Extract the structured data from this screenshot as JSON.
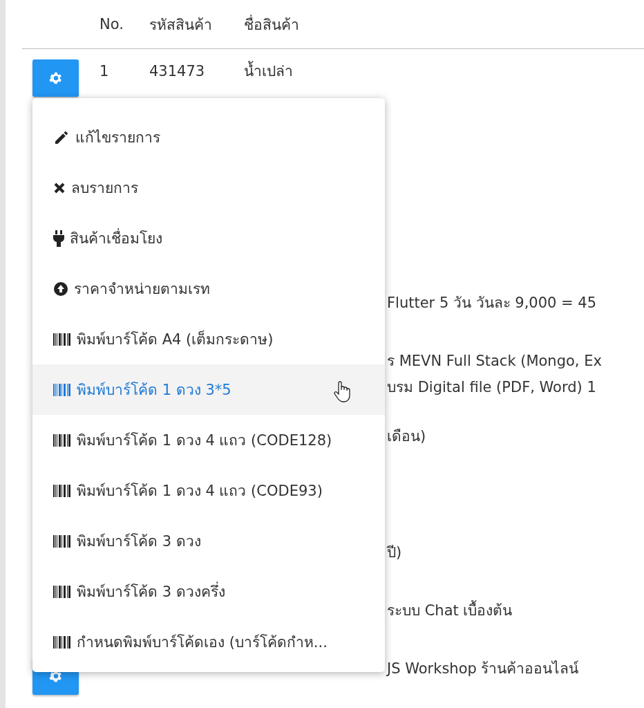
{
  "table": {
    "columns": [
      "No.",
      "รหัสสินค้า",
      "ชื่อสินค้า"
    ],
    "rows": [
      {
        "kind": "full",
        "no": "1",
        "code": "431473",
        "name": "น้ำเปล่า"
      },
      {
        "kind": "covered",
        "name_lines": [
          "Flutter 5 วัน วันละ 9,000 = 45"
        ]
      },
      {
        "kind": "covered",
        "name_lines": [
          "ร MEVN Full Stack (Mongo, Ex",
          "บรม Digital file (PDF, Word) 1"
        ]
      },
      {
        "kind": "covered",
        "name_lines": [
          "เดือน)"
        ]
      },
      {
        "kind": "covered",
        "name_lines": [
          "ปี)"
        ]
      },
      {
        "kind": "covered",
        "name_lines": [
          "ระบบ Chat เบื้องต้น"
        ]
      },
      {
        "kind": "covered_with_button",
        "name_lines": [
          "JS Workshop ร้านค้าออนไลน์"
        ]
      }
    ]
  },
  "menu": {
    "items": [
      {
        "kind": "edit",
        "label": "แก้ไขรายการ",
        "selected": false
      },
      {
        "kind": "delete",
        "label": "ลบรายการ",
        "selected": false
      },
      {
        "kind": "plug",
        "label": "สินค้าเชื่อมโยง",
        "selected": false
      },
      {
        "kind": "upload",
        "label": "ราคาจำหน่ายตามเรท",
        "selected": false
      },
      {
        "kind": "barcode",
        "label": "พิมพ์บาร์โค้ด A4 (เต็มกระดาษ)",
        "selected": false
      },
      {
        "kind": "barcode",
        "label": "พิมพ์บาร์โค้ด 1 ดวง 3*5",
        "selected": true
      },
      {
        "kind": "barcode",
        "label": "พิมพ์บาร์โค้ด 1 ดวง 4 แถว (CODE128)",
        "selected": false
      },
      {
        "kind": "barcode",
        "label": "พิมพ์บาร์โค้ด 1 ดวง 4 แถว (CODE93)",
        "selected": false
      },
      {
        "kind": "barcode",
        "label": "พิมพ์บาร์โค้ด 3 ดวง",
        "selected": false
      },
      {
        "kind": "barcode",
        "label": "พิมพ์บาร์โค้ด 3 ดวงครึ่ง",
        "selected": false
      },
      {
        "kind": "barcode",
        "label": "กำหนดพิมพ์บาร์โค้ดเอง (บาร์โค้ดกำห...",
        "selected": false
      }
    ]
  }
}
